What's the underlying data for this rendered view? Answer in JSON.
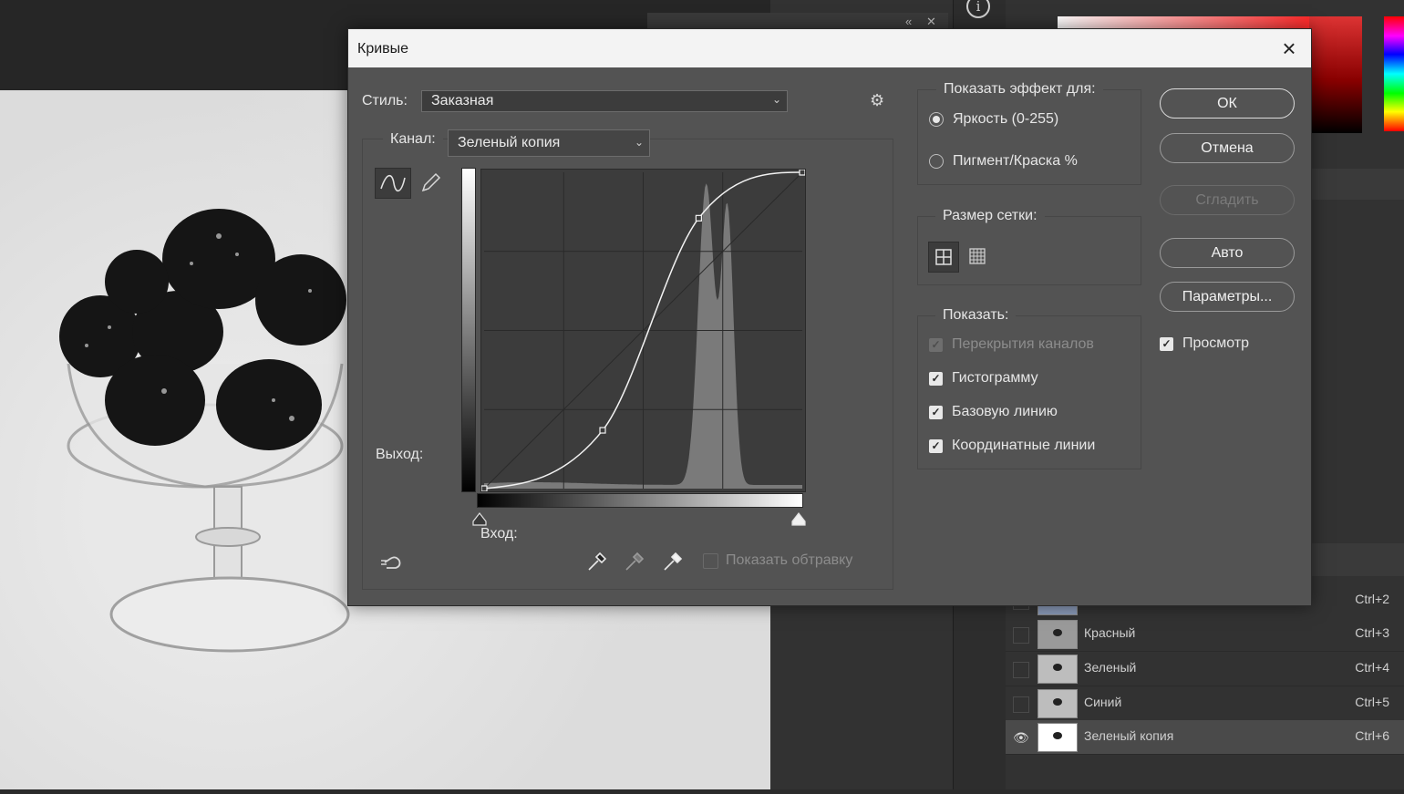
{
  "dialog": {
    "title": "Кривые",
    "style_label": "Стиль:",
    "style_value": "Заказная",
    "channel_label": "Канал:",
    "channel_value": "Зеленый копия",
    "output_label": "Выход:",
    "input_label": "Вход:",
    "show_clipping": "Показать обтравку",
    "show_effect_title": "Показать эффект для:",
    "radio_brightness": "Яркость (0-255)",
    "radio_pigment": "Пигмент/Краска %",
    "grid_size_title": "Размер сетки:",
    "show_title": "Показать:",
    "opt_channel_overlays": "Перекрытия каналов",
    "opt_histogram": "Гистограмму",
    "opt_baseline": "Базовую линию",
    "opt_intersection": "Координатные линии",
    "btn_ok": "ОК",
    "btn_cancel": "Отмена",
    "btn_smooth": "Сгладить",
    "btn_auto": "Авто",
    "btn_options": "Параметры...",
    "preview_label": "Просмотр"
  },
  "curve": {
    "input_range": [
      0,
      255
    ],
    "output_range": [
      0,
      255
    ],
    "points": [
      [
        0,
        0
      ],
      [
        95,
        47
      ],
      [
        172,
        218
      ],
      [
        255,
        255
      ]
    ]
  },
  "channels": [
    {
      "name": "",
      "shortcut": "Ctrl+2"
    },
    {
      "name": "Красный",
      "shortcut": "Ctrl+3"
    },
    {
      "name": "Зеленый",
      "shortcut": "Ctrl+4"
    },
    {
      "name": "Синий",
      "shortcut": "Ctrl+5"
    },
    {
      "name": "Зеленый копия",
      "shortcut": "Ctrl+6"
    }
  ],
  "icons": {
    "close": "close-icon",
    "gear": "gear-icon",
    "curve_tool": "curve-tool-icon",
    "pencil_tool": "pencil-icon",
    "eyedroppers": [
      "black-eyedropper-icon",
      "gray-eyedropper-icon",
      "white-eyedropper-icon"
    ],
    "hand_tool": "on-image-adjust-icon",
    "info": "info-icon",
    "eye": "eye-icon"
  }
}
